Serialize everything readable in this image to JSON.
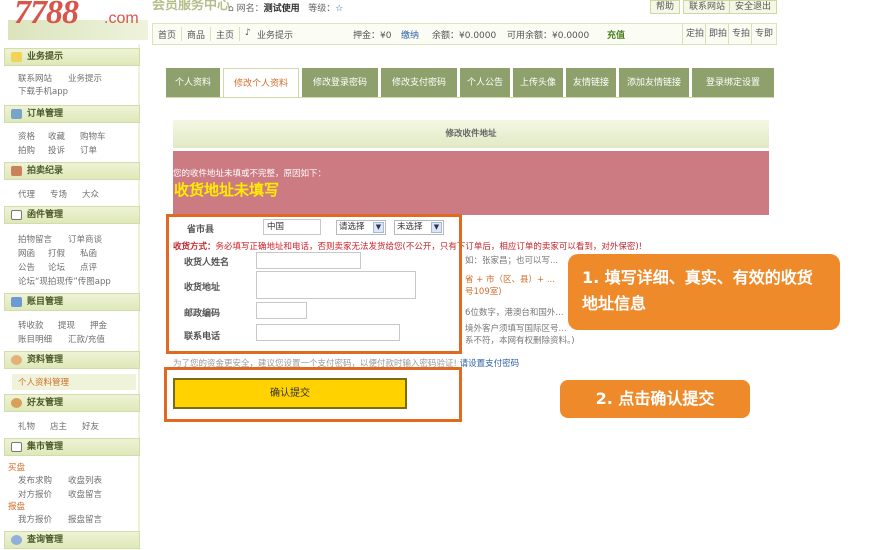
{
  "header": {
    "logo_number": "7788",
    "logo_domain": ".com",
    "member_center": "会员服务中心",
    "netname_label": "网名：",
    "netname_value": "测试使用",
    "level_label": "等级：",
    "level_star": "☆",
    "links": [
      "帮助",
      "联系网站",
      "安全退出"
    ]
  },
  "topnav": {
    "items": [
      "首页",
      "商品",
      "主页"
    ],
    "business": "业务提示",
    "deposit": "押金：¥0",
    "deposit_action": "缴纳",
    "balance": "余额：¥0.0000",
    "available": "可用余额：¥0.0000",
    "recharge": "充值",
    "right_buttons": [
      "定拍",
      "即拍",
      "专拍",
      "专即"
    ]
  },
  "sidebar": {
    "sections": [
      {
        "title": "业务提示",
        "links": [
          "联系网站",
          "业务提示",
          "下载手机app"
        ]
      },
      {
        "title": "订单管理",
        "links": [
          "资格",
          "收藏",
          "购物车",
          "拍购",
          "投诉",
          "订单"
        ]
      },
      {
        "title": "拍卖纪录",
        "links": [
          "代理",
          "专场",
          "大众"
        ]
      },
      {
        "title": "函件管理",
        "links": [
          "拍物留言",
          "订单商谈",
          "网函",
          "打假",
          "私函",
          "公告",
          "论坛",
          "点评",
          "论坛“现拍现传”传图app"
        ]
      },
      {
        "title": "账目管理",
        "links": [
          "转收款",
          "提现",
          "押金",
          "账目明细",
          "汇款/充值"
        ]
      },
      {
        "title": "资料管理",
        "links": [
          "个人资料管理"
        ]
      },
      {
        "title": "好友管理",
        "links": [
          "礼物",
          "店主",
          "好友"
        ]
      },
      {
        "title": "集市管理",
        "links": [
          "买盘",
          "发布求购",
          "收盘列表",
          "对方报价",
          "收盘留言",
          "报盘",
          "我方报价",
          "报盘留言"
        ]
      },
      {
        "title": "查询管理",
        "links": []
      }
    ]
  },
  "tabs": [
    "个人资料",
    "修改个人资料",
    "修改登录密码",
    "修改支付密码",
    "个人公告",
    "上传头像",
    "友情链接",
    "添加友情链接",
    "登录绑定设置"
  ],
  "form": {
    "header": "修改收件地址",
    "warning_line": "您的收件地址未填或不完整，原因如下：",
    "warning_big": "收货地址未填写",
    "province_label": "省市县",
    "country_value": "中国",
    "province_select": "请选择",
    "city_select": "未选择",
    "ship_label": "收货方式：",
    "ship_warning": "务必填写正确地址和电话，否则卖家无法发货给您",
    "ship_note": "(不公开，只有下订单后，相应订单的卖家可以看到，对外保密)!",
    "name_label": "收货人姓名",
    "address_label": "收货地址",
    "postcode_label": "邮政编码",
    "phone_label": "联系电话",
    "name_value": "",
    "address_value": "",
    "postcode_value": "",
    "phone_value": "",
    "name_hint": "如：张家昌；也可以写...",
    "address_hint": "省 + 市（区、县）+ ...",
    "address_hint2": "号109室)",
    "postcode_hint": "6位数字，港澳台和国外...",
    "phone_hint": "境外客户须填写国际区号...",
    "phone_hint2": "系不符，本网有权删除资料。)",
    "security_tip": "为了您的资金更安全，建议您设置一个支付密码，以便付款时输入密码验证!",
    "security_link": "请设置支付密码",
    "submit": "确认提交"
  },
  "callouts": {
    "one": "1. 填写详细、真实、有效的收货地址信息",
    "two": "2. 点击确认提交"
  }
}
